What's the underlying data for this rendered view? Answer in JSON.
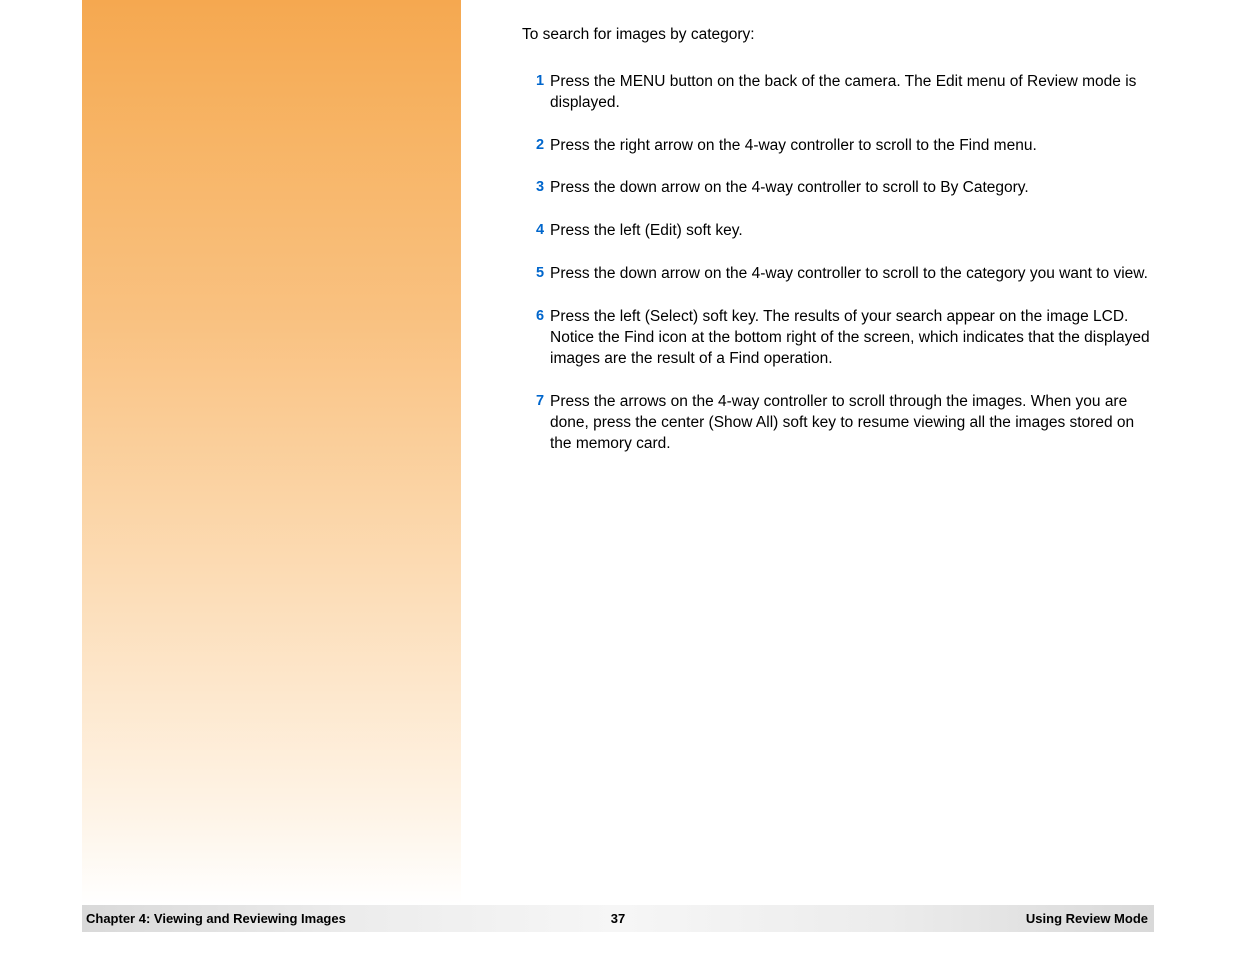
{
  "intro": "To search for images by category:",
  "steps": [
    {
      "n": "1",
      "text": "Press the MENU button on the back of the camera. The Edit menu of Review mode is displayed."
    },
    {
      "n": "2",
      "text": "Press the right arrow on the 4-way controller to scroll to the Find menu."
    },
    {
      "n": "3",
      "text": "Press the down arrow on the 4-way controller to scroll to By Category."
    },
    {
      "n": "4",
      "text": "Press the left (Edit) soft key."
    },
    {
      "n": "5",
      "text": "Press the down arrow on the 4-way controller to scroll to the category you want to view."
    },
    {
      "n": "6",
      "text": "Press the left (Select) soft key. The results of your search appear on the image LCD. Notice the Find icon at the bottom right of the screen, which indicates that the displayed images are the result of a Find operation."
    },
    {
      "n": "7",
      "text": "Press the arrows on the 4-way controller to scroll through the images. When you are done, press the center (Show All) soft key to resume viewing all the images stored on the memory card."
    }
  ],
  "footer": {
    "left": "Chapter 4: Viewing and Reviewing Images",
    "center": "37",
    "right": "Using Review Mode"
  }
}
